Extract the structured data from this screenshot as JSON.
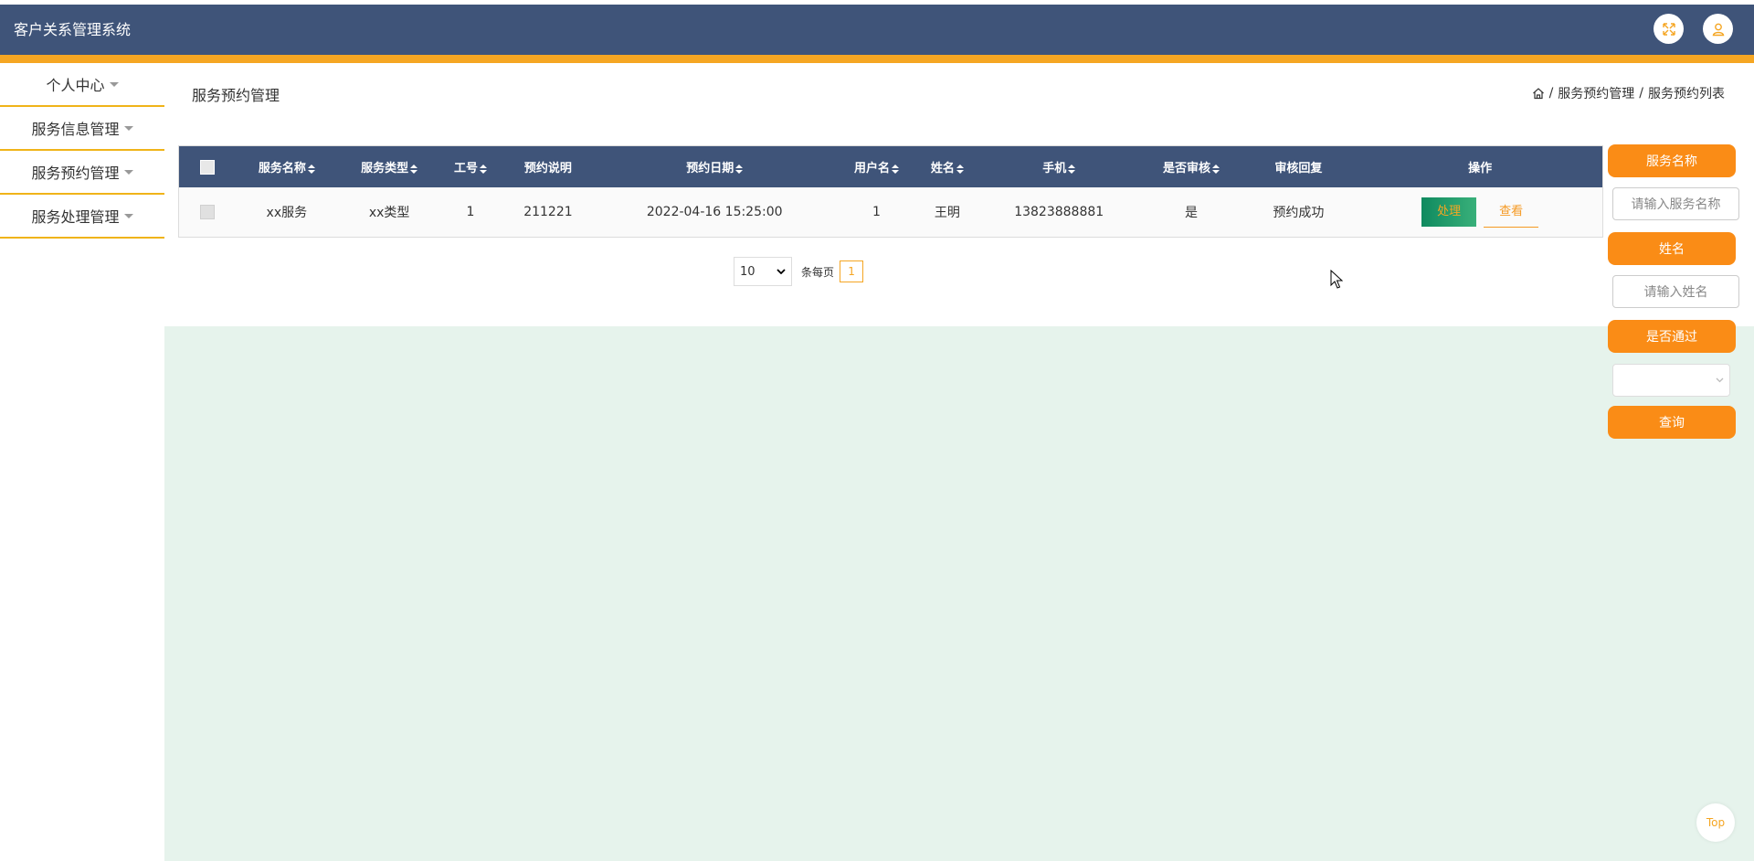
{
  "app": {
    "title": "客户关系管理系统"
  },
  "header": {
    "fullscreen_icon": "expand-icon",
    "user_icon": "user-icon"
  },
  "sidebar": {
    "items": [
      {
        "label": "个人中心"
      },
      {
        "label": "服务信息管理"
      },
      {
        "label": "服务预约管理"
      },
      {
        "label": "服务处理管理"
      }
    ]
  },
  "page": {
    "title": "服务预约管理"
  },
  "breadcrumb": {
    "items": [
      "服务预约管理",
      "服务预约列表"
    ]
  },
  "table": {
    "columns": [
      "服务名称",
      "服务类型",
      "工号",
      "预约说明",
      "预约日期",
      "用户名",
      "姓名",
      "手机",
      "是否审核",
      "审核回复",
      "操作"
    ],
    "rows": [
      {
        "service_name": "xx服务",
        "service_type": "xx类型",
        "job_no": "1",
        "note": "211221",
        "date": "2022-04-16 15:25:00",
        "username": "1",
        "name": "王明",
        "phone": "13823888881",
        "reviewed": "是",
        "reply": "预约成功",
        "actions": {
          "process": "处理",
          "view": "查看"
        }
      }
    ]
  },
  "pager": {
    "page_size": "10",
    "per_page_label": "条每页",
    "current_page": "1"
  },
  "search": {
    "service_name_label": "服务名称",
    "service_name_placeholder": "请输入服务名称",
    "name_label": "姓名",
    "name_placeholder": "请输入姓名",
    "passed_label": "是否通过",
    "passed_value": "",
    "query_label": "查询"
  },
  "back_to_top": "Top",
  "colors": {
    "header": "#3f5479",
    "accent": "#f5a623",
    "button": "#fa8c16",
    "content_bg": "#e6f3ec"
  }
}
